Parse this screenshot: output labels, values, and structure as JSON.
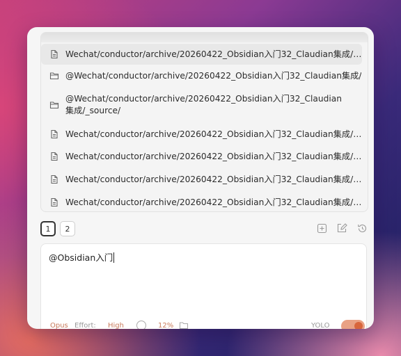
{
  "suggestions": [
    {
      "type": "file",
      "label": "Wechat/conductor/archive/20260422_Obsidian入门32_Claudian集成/…",
      "icon": "file-icon"
    },
    {
      "type": "folder",
      "label": "@Wechat/conductor/archive/20260422_Obsidian入门32_Claudian集成/",
      "icon": "folder-icon"
    },
    {
      "type": "folder",
      "label": "@Wechat/conductor/archive/20260422_Obsidian入门32_Claudian集成/_source/",
      "icon": "folder-icon"
    },
    {
      "type": "file",
      "label": "Wechat/conductor/archive/20260422_Obsidian入门32_Claudian集成/…",
      "icon": "file-icon"
    },
    {
      "type": "file",
      "label": "Wechat/conductor/archive/20260422_Obsidian入门32_Claudian集成/…",
      "icon": "file-icon"
    },
    {
      "type": "file",
      "label": "Wechat/conductor/archive/20260422_Obsidian入门32_Claudian集成/…",
      "icon": "file-icon"
    },
    {
      "type": "file",
      "label": "Wechat/conductor/archive/20260422_Obsidian入门32_Claudian集成/…",
      "icon": "file-icon"
    }
  ],
  "tabs": [
    "1",
    "2"
  ],
  "toolbar_icons": [
    "new-tab-icon",
    "edit-icon",
    "history-icon"
  ],
  "editor": {
    "value": "@Obsidian入门"
  },
  "status": {
    "model": "Opus",
    "effort_label": "Effort:",
    "effort_value": "High",
    "context_percent": "12%",
    "mode": "YOLO"
  },
  "colors": {
    "accent": "#d8653c",
    "status_text": "#c87a5a"
  }
}
